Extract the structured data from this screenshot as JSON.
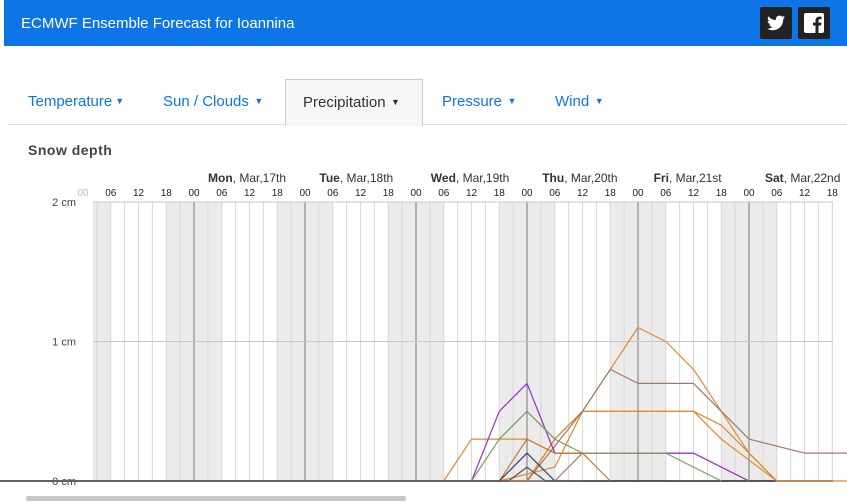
{
  "header": {
    "title": "ECMWF Ensemble Forecast for Ioannina",
    "social": [
      {
        "icon": "twitter-icon"
      },
      {
        "icon": "facebook-icon"
      }
    ],
    "color": "#0d75e6"
  },
  "tabs": [
    {
      "label": "Temperature",
      "name": "tab-temperature",
      "active": false
    },
    {
      "label": "Sun / Clouds",
      "name": "tab-sun-clouds",
      "active": false
    },
    {
      "label": "Precipitation",
      "name": "tab-precipitation",
      "active": true
    },
    {
      "label": "Pressure",
      "name": "tab-pressure",
      "active": false
    },
    {
      "label": "Wind",
      "name": "tab-wind",
      "active": false
    }
  ],
  "section_title": "Snow depth",
  "chart_data": {
    "type": "line",
    "title": "Snow depth",
    "y_unit": "cm",
    "ylim": [
      0,
      2
    ],
    "y_ticks": [
      {
        "value": 0,
        "label": "0 cm"
      },
      {
        "value": 1,
        "label": "1 cm"
      },
      {
        "value": 2,
        "label": "2 cm"
      }
    ],
    "days": [
      {
        "bold": "Mon",
        "rest": ", Mar,17th"
      },
      {
        "bold": "Tue",
        "rest": ", Mar,18th"
      },
      {
        "bold": "Wed",
        "rest": ", Mar,19th"
      },
      {
        "bold": "Thu",
        "rest": ", Mar,20th"
      },
      {
        "bold": "Fri",
        "rest": ", Mar,21st"
      },
      {
        "bold": "Sat",
        "rest": ", Mar,22nd"
      }
    ],
    "hour_labels": [
      "00",
      "06",
      "12",
      "18"
    ],
    "x_unit": "hours since Mon, Mar 17 00:00",
    "grid": true,
    "series": [
      {
        "color": "#e08a2a",
        "points": [
          [
            -72,
            0
          ],
          [
            54,
            0
          ],
          [
            60,
            0.3
          ],
          [
            72,
            0.3
          ],
          [
            78,
            0.2
          ],
          [
            84,
            0.2
          ]
        ]
      },
      {
        "color": "#e08a2a",
        "points": [
          [
            -72,
            0
          ],
          [
            66,
            0
          ],
          [
            78,
            0.1
          ],
          [
            84,
            0.5
          ],
          [
            90,
            0.8
          ],
          [
            96,
            1.1
          ],
          [
            102,
            1.0
          ],
          [
            108,
            0.8
          ],
          [
            114,
            0.5
          ],
          [
            120,
            0.2
          ],
          [
            126,
            0
          ],
          [
            150,
            0
          ]
        ]
      },
      {
        "color": "#e08a2a",
        "points": [
          [
            -72,
            0
          ],
          [
            72,
            0
          ],
          [
            78,
            0.3
          ],
          [
            84,
            0.5
          ],
          [
            96,
            0.5
          ],
          [
            108,
            0.5
          ],
          [
            114,
            0.4
          ],
          [
            120,
            0.2
          ],
          [
            126,
            0
          ]
        ]
      },
      {
        "color": "#e08a2a",
        "points": [
          [
            -72,
            0
          ],
          [
            72,
            0
          ],
          [
            78,
            0.3
          ],
          [
            84,
            0.5
          ],
          [
            108,
            0.5
          ],
          [
            114,
            0.3
          ],
          [
            126,
            0
          ]
        ]
      },
      {
        "color": "#a07868",
        "points": [
          [
            -72,
            0
          ],
          [
            72,
            0
          ],
          [
            84,
            0.5
          ],
          [
            90,
            0.8
          ],
          [
            96,
            0.7
          ],
          [
            108,
            0.7
          ],
          [
            120,
            0.3
          ],
          [
            132,
            0.2
          ],
          [
            144,
            0.2
          ],
          [
            156,
            0.2
          ],
          [
            162,
            0.1
          ],
          [
            168,
            0
          ],
          [
            180,
            0
          ]
        ]
      },
      {
        "color": "#a07868",
        "points": [
          [
            -72,
            0
          ],
          [
            78,
            0
          ],
          [
            84,
            0.2
          ],
          [
            96,
            0.2
          ],
          [
            108,
            0.2
          ],
          [
            114,
            0.1
          ],
          [
            120,
            0
          ]
        ]
      },
      {
        "color": "#9b30c8",
        "points": [
          [
            -72,
            0
          ],
          [
            60,
            0
          ],
          [
            66,
            0.5
          ],
          [
            72,
            0.7
          ],
          [
            78,
            0.2
          ],
          [
            84,
            0.2
          ],
          [
            108,
            0.2
          ],
          [
            114,
            0.1
          ],
          [
            120,
            0
          ]
        ]
      },
      {
        "color": "#7b9b60",
        "points": [
          [
            -72,
            0
          ],
          [
            60,
            0
          ],
          [
            66,
            0.3
          ],
          [
            72,
            0.5
          ],
          [
            78,
            0.3
          ],
          [
            84,
            0.2
          ],
          [
            96,
            0.2
          ],
          [
            102,
            0.2
          ],
          [
            108,
            0.1
          ],
          [
            114,
            0
          ]
        ]
      },
      {
        "color": "#c8782a",
        "points": [
          [
            -72,
            0
          ],
          [
            66,
            0
          ],
          [
            72,
            0.3
          ],
          [
            78,
            0.2
          ],
          [
            84,
            0.2
          ],
          [
            90,
            0
          ]
        ]
      },
      {
        "color": "#3a3a7a",
        "points": [
          [
            -72,
            0
          ],
          [
            66,
            0
          ],
          [
            72,
            0.2
          ],
          [
            78,
            0
          ],
          [
            84,
            0
          ]
        ]
      },
      {
        "color": "#555555",
        "points": [
          [
            -72,
            0
          ],
          [
            68,
            0
          ],
          [
            72,
            0.1
          ],
          [
            76,
            0
          ],
          [
            84,
            0
          ]
        ]
      }
    ]
  }
}
